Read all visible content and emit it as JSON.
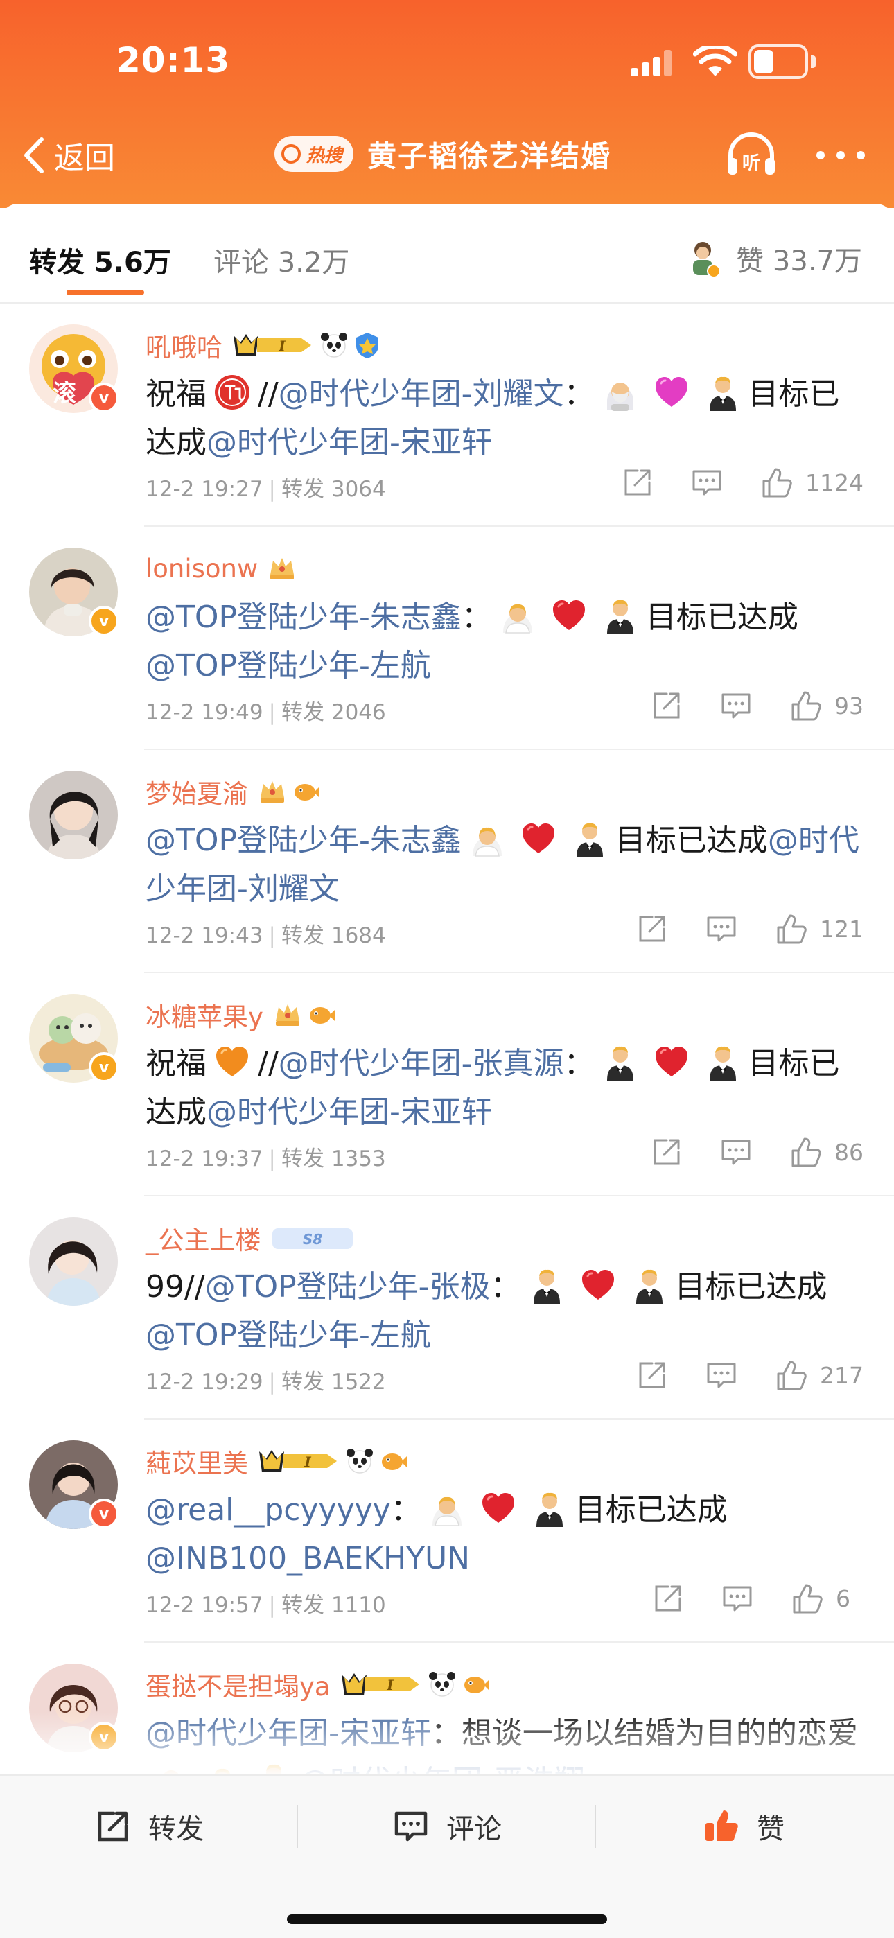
{
  "status": {
    "time": "20:13"
  },
  "nav": {
    "back_label": "返回",
    "hot_label": "热搜",
    "title": "黄子韬徐艺洋结婚",
    "listen_label": "听"
  },
  "tabs": {
    "repost": "转发 5.6万",
    "comment": "评论 3.2万",
    "likes": "赞 33.7万"
  },
  "posts": [
    {
      "user": "吼哦哈",
      "avatar_char": "滚",
      "level_num": "I",
      "badge_color": "#f55a3c",
      "content_parts": [
        {
          "t": "text",
          "v": "祝福"
        },
        {
          "t": "emoji",
          "icon": "zhu-blessing-emoji"
        },
        {
          "t": "text",
          "v": "//"
        },
        {
          "t": "mention",
          "v": "@时代少年团-刘耀文"
        },
        {
          "t": "text",
          "v": "："
        },
        {
          "t": "emoji",
          "icon": "man-in-veil-emoji"
        },
        {
          "t": "emoji",
          "icon": "pink-heart-emoji"
        },
        {
          "t": "emoji",
          "icon": "man-in-tuxedo-emoji"
        },
        {
          "t": "text",
          "v": "目标已达成"
        },
        {
          "t": "mention",
          "v": "@时代少年团-宋亚轩"
        }
      ],
      "time": "12-2 19:27",
      "repost_label": "转发 3064",
      "likes": "1124"
    },
    {
      "user": "lonisonw",
      "badge_color": "#f7a51d",
      "content_parts": [
        {
          "t": "mention",
          "v": "@TOP登陆少年-朱志鑫"
        },
        {
          "t": "text",
          "v": "："
        },
        {
          "t": "emoji",
          "icon": "bride-emoji"
        },
        {
          "t": "emoji",
          "icon": "red-heart-emoji"
        },
        {
          "t": "emoji",
          "icon": "man-in-tuxedo-emoji"
        },
        {
          "t": "text",
          "v": "目标已达成"
        },
        {
          "t": "mention",
          "v": "@TOP登陆少年-左航"
        }
      ],
      "time": "12-2 19:49",
      "repost_label": "转发 2046",
      "likes": "93"
    },
    {
      "user": "梦始夏渝",
      "content_parts": [
        {
          "t": "mention",
          "v": "@TOP登陆少年-朱志鑫"
        },
        {
          "t": "emoji",
          "icon": "bride-emoji"
        },
        {
          "t": "emoji",
          "icon": "red-heart-emoji"
        },
        {
          "t": "emoji",
          "icon": "man-in-tuxedo-emoji"
        },
        {
          "t": "text",
          "v": "目标已达成"
        },
        {
          "t": "mention",
          "v": "@时代少年团-刘耀文"
        }
      ],
      "time": "12-2 19:43",
      "repost_label": "转发 1684",
      "likes": "121"
    },
    {
      "user": "冰糖苹果y",
      "badge_color": "#f7a51d",
      "content_parts": [
        {
          "t": "text",
          "v": "祝福"
        },
        {
          "t": "emoji",
          "icon": "orange-heart-emoji"
        },
        {
          "t": "text",
          "v": "//"
        },
        {
          "t": "mention",
          "v": "@时代少年团-张真源"
        },
        {
          "t": "text",
          "v": "："
        },
        {
          "t": "emoji",
          "icon": "man-in-tuxedo-emoji"
        },
        {
          "t": "emoji",
          "icon": "red-heart-emoji"
        },
        {
          "t": "emoji",
          "icon": "man-in-tuxedo-emoji"
        },
        {
          "t": "text",
          "v": "目标已达成"
        },
        {
          "t": "mention",
          "v": "@时代少年团-宋亚轩"
        }
      ],
      "time": "12-2 19:37",
      "repost_label": "转发 1353",
      "likes": "86"
    },
    {
      "user": "_公主上楼",
      "content_parts": [
        {
          "t": "text",
          "v": "99//"
        },
        {
          "t": "mention",
          "v": "@TOP登陆少年-张极"
        },
        {
          "t": "text",
          "v": "："
        },
        {
          "t": "emoji",
          "icon": "man-in-tuxedo-emoji"
        },
        {
          "t": "emoji",
          "icon": "red-heart-emoji"
        },
        {
          "t": "emoji",
          "icon": "man-in-tuxedo-emoji"
        },
        {
          "t": "text",
          "v": "目标已达成"
        },
        {
          "t": "mention",
          "v": "@TOP登陆少年-左航"
        }
      ],
      "time": "12-2 19:29",
      "repost_label": "转发 1522",
      "likes": "217"
    },
    {
      "user": "蒓苡里美",
      "level_num": "I",
      "badge_color": "#f55a3c",
      "content_parts": [
        {
          "t": "mention",
          "v": "@real__pcyyyyy"
        },
        {
          "t": "text",
          "v": "："
        },
        {
          "t": "emoji",
          "icon": "bride-emoji"
        },
        {
          "t": "emoji",
          "icon": "red-heart-emoji"
        },
        {
          "t": "emoji",
          "icon": "man-in-tuxedo-emoji"
        },
        {
          "t": "text",
          "v": "目标已达成"
        },
        {
          "t": "mention",
          "v": "@INB100_BAEKHYUN"
        }
      ],
      "time": "12-2 19:57",
      "repost_label": "转发 1110",
      "likes": "6"
    },
    {
      "user": "蛋挞不是担塌ya",
      "level_num": "I",
      "badge_color": "#f7a51d",
      "content_parts": [
        {
          "t": "mention",
          "v": "@时代少年团-宋亚轩"
        },
        {
          "t": "text",
          "v": "：想谈一场以结婚为目的的恋爱"
        },
        {
          "t": "emoji",
          "icon": "man-in-veil-emoji"
        },
        {
          "t": "emoji",
          "icon": "bride-emoji"
        },
        {
          "t": "emoji",
          "icon": "man-in-tuxedo-emoji"
        },
        {
          "t": "mention",
          "v": "@时代少年团-严浩翔"
        }
      ]
    }
  ],
  "bottom": {
    "repost": "转发",
    "comment": "评论",
    "like": "赞"
  },
  "colors": {
    "brand_orange": "#f7622c",
    "username": "#eb7350",
    "mention": "#4e6fa3",
    "meta": "#999999"
  }
}
